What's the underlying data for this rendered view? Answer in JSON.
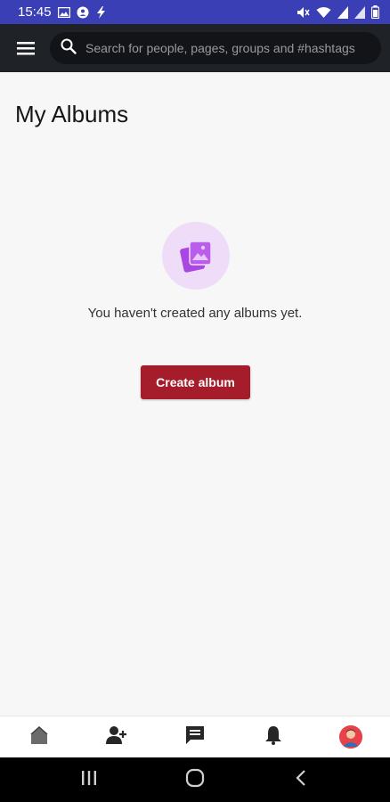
{
  "status_bar": {
    "time": "15:45"
  },
  "app_bar": {
    "search_placeholder": "Search for people, pages, groups and #hashtags"
  },
  "page": {
    "title": "My Albums",
    "empty_message": "You haven't created any albums yet.",
    "create_button": "Create album"
  },
  "colors": {
    "status_bar_bg": "#3a3fb5",
    "app_bar_bg": "#1f2227",
    "accent_button": "#a51d2a",
    "empty_icon_bg": "#efdcf9",
    "empty_icon_fg": "#a848e0"
  },
  "bottom_nav": {
    "items": [
      "home-icon",
      "add-friend-icon",
      "messages-icon",
      "notifications-icon",
      "profile-avatar"
    ]
  },
  "system_nav": {
    "items": [
      "recent-apps-icon",
      "home-circle-icon",
      "back-icon"
    ]
  }
}
